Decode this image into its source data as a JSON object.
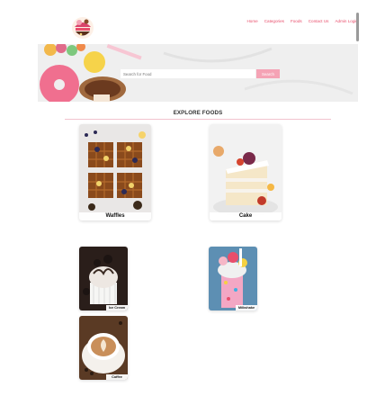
{
  "nav": {
    "items": [
      "Home",
      "Categories",
      "Foods",
      "Contact Us",
      "Admin Login"
    ]
  },
  "search": {
    "placeholder": "Search for Food",
    "button_label": "Search"
  },
  "section": {
    "title": "EXPLORE FOODS"
  },
  "foods": [
    "Waffles",
    "Cake",
    "Ice Cream",
    "Milkshake",
    "Coffee"
  ],
  "colors": {
    "accent": "#e84e6b",
    "button": "#f5a3b5",
    "rule": "#f2c3ce"
  }
}
